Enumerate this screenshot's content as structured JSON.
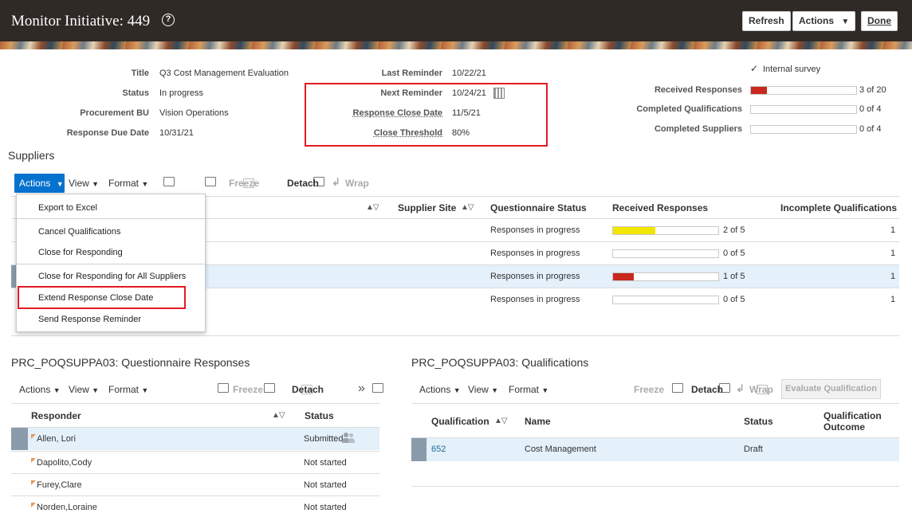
{
  "header": {
    "title": "Monitor Initiative: 449",
    "help_glyph": "?",
    "refresh_label": "Refresh",
    "actions_label": "Actions",
    "done_label": "Done"
  },
  "summary": {
    "title_label": "Title",
    "title_value": "Q3 Cost Management Evaluation",
    "status_label": "Status",
    "status_value": "In progress",
    "bu_label": "Procurement BU",
    "bu_value": "Vision Operations",
    "due_label": "Response Due Date",
    "due_value": "10/31/21",
    "last_reminder_label": "Last Reminder",
    "last_reminder_value": "10/22/21",
    "next_reminder_label": "Next Reminder",
    "next_reminder_value": "10/24/21",
    "close_date_label": "Response Close Date",
    "close_date_value": "11/5/21",
    "threshold_label": "Close Threshold",
    "threshold_value": "80%",
    "internal_survey_label": "Internal survey",
    "received_label": "Received Responses",
    "received_value": "3 of 20",
    "received_fraction": 0.15,
    "completed_q_label": "Completed Qualifications",
    "completed_q_value": "0 of 4",
    "completed_s_label": "Completed Suppliers",
    "completed_s_value": "0 of 4"
  },
  "suppliers": {
    "section_title": "Suppliers",
    "toolbar": {
      "actions": "Actions",
      "view": "View",
      "format": "Format",
      "freeze": "Freeze",
      "detach": "Detach",
      "wrap": "Wrap"
    },
    "columns": {
      "site": "Supplier Site",
      "qstatus": "Questionnaire Status",
      "received": "Received Responses",
      "incomplete": "Incomplete Qualifications"
    },
    "rows": [
      {
        "qstatus": "Responses in progress",
        "received": "2 of 5",
        "fraction": 0.4,
        "color": "#f2e600",
        "incomplete": "1"
      },
      {
        "qstatus": "Responses in progress",
        "received": "0 of 5",
        "fraction": 0,
        "color": "#c8281e",
        "incomplete": "1"
      },
      {
        "qstatus": "Responses in progress",
        "received": "1 of 5",
        "fraction": 0.2,
        "color": "#c8281e",
        "incomplete": "1"
      },
      {
        "qstatus": "Responses in progress",
        "received": "0 of 5",
        "fraction": 0,
        "color": "#c8281e",
        "incomplete": "1"
      }
    ],
    "menu": {
      "export": "Export to Excel",
      "cancel_q": "Cancel Qualifications",
      "close_resp": "Close for Responding",
      "close_all": "Close for Responding for All Suppliers",
      "extend": "Extend Response Close Date",
      "reminder": "Send Response Reminder"
    }
  },
  "responses": {
    "section_title": "PRC_POQSUPPA03: Questionnaire Responses",
    "toolbar": {
      "actions": "Actions",
      "view": "View",
      "format": "Format",
      "freeze": "Freeze",
      "detach": "Detach",
      "more": "»"
    },
    "columns": {
      "responder": "Responder",
      "status": "Status"
    },
    "rows": [
      {
        "responder": "Allen, Lori",
        "status": "Submitted"
      },
      {
        "responder": "Dapolito,Cody",
        "status": "Not started"
      },
      {
        "responder": "Furey,Clare",
        "status": "Not started"
      },
      {
        "responder": "Norden,Loraine",
        "status": "Not started"
      }
    ]
  },
  "qualifications": {
    "section_title": "PRC_POQSUPPA03: Qualifications",
    "toolbar": {
      "actions": "Actions",
      "view": "View",
      "format": "Format",
      "freeze": "Freeze",
      "detach": "Detach",
      "wrap": "Wrap",
      "evaluate": "Evaluate Qualification"
    },
    "columns": {
      "qualification": "Qualification",
      "name": "Name",
      "status": "Status",
      "outcome_1": "Qualification",
      "outcome_2": "Outcome"
    },
    "rows": [
      {
        "qualification": "652",
        "name": "Cost Management",
        "status": "Draft",
        "outcome": ""
      }
    ]
  },
  "colors": {
    "header_bg": "#302a26",
    "accent": "#0572ce",
    "alert_red": "#e21b23",
    "selected_row": "#e4f0fa"
  }
}
